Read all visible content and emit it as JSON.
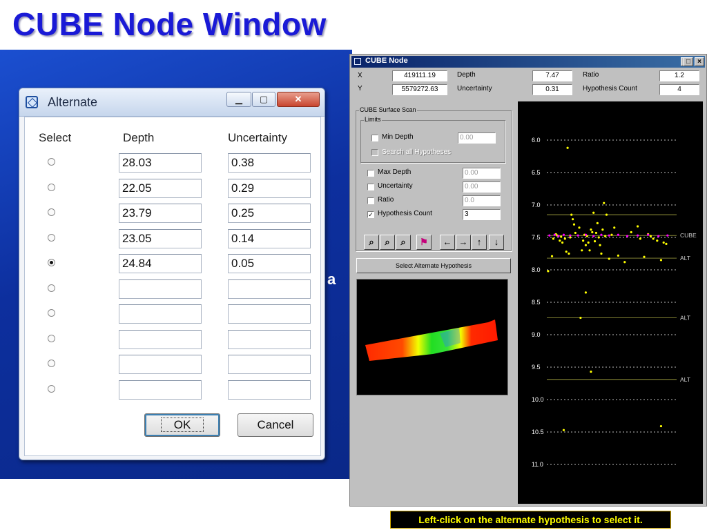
{
  "slide": {
    "title": "CUBE Node Window",
    "caption": "Left-click on the alternate hypothesis to select it.",
    "background_fragment": "a"
  },
  "alternate_dialog": {
    "title": "Alternate",
    "window_buttons": [
      "minimize-icon",
      "maximize-icon",
      "close-icon"
    ],
    "columns": {
      "select": "Select",
      "depth": "Depth",
      "uncertainty": "Uncertainty"
    },
    "rows": [
      {
        "selected": false,
        "depth": "28.03",
        "uncertainty": "0.38"
      },
      {
        "selected": false,
        "depth": "22.05",
        "uncertainty": "0.29"
      },
      {
        "selected": false,
        "depth": "23.79",
        "uncertainty": "0.25"
      },
      {
        "selected": false,
        "depth": "23.05",
        "uncertainty": "0.14"
      },
      {
        "selected": true,
        "depth": "24.84",
        "uncertainty": "0.05"
      },
      {
        "selected": false,
        "depth": "",
        "uncertainty": ""
      },
      {
        "selected": false,
        "depth": "",
        "uncertainty": ""
      },
      {
        "selected": false,
        "depth": "",
        "uncertainty": ""
      },
      {
        "selected": false,
        "depth": "",
        "uncertainty": ""
      },
      {
        "selected": false,
        "depth": "",
        "uncertainty": ""
      }
    ],
    "ok_label": "OK",
    "cancel_label": "Cancel"
  },
  "cube_node": {
    "title": "CUBE Node",
    "x_label": "X",
    "x_value": "419111.19",
    "y_label": "Y",
    "y_value": "5579272.63",
    "depth_label": "Depth",
    "depth_value": "7.47",
    "uncertainty_label": "Uncertainty",
    "uncertainty_value": "0.31",
    "ratio_label": "Ratio",
    "ratio_value": "1.2",
    "hypothesis_count_label": "Hypothesis Count",
    "hypothesis_count_value": "4",
    "scan_group": "CUBE Surface Scan",
    "limits_group": "Limits",
    "filters": {
      "min_depth": {
        "label": "Min Depth",
        "checked": false,
        "value": "0.00"
      },
      "search_all": {
        "label": "Search all Hypotheses",
        "checked": false,
        "enabled": false
      },
      "max_depth": {
        "label": "Max Depth",
        "checked": false,
        "value": "0.00"
      },
      "uncertainty": {
        "label": "Uncertainty",
        "checked": false,
        "value": "0.00"
      },
      "ratio": {
        "label": "Ratio",
        "checked": false,
        "value": "0.0"
      },
      "hypothesis_count": {
        "label": "Hypothesis Count",
        "checked": true,
        "value": "3"
      }
    },
    "toolbar": [
      "binoculars-icon",
      "binoculars-plus-icon",
      "binoculars-minus-icon",
      "scan-tool-icon",
      "arrow-left-icon",
      "arrow-right-icon",
      "arrow-up-icon",
      "arrow-down-icon"
    ],
    "select_alternate_label": "Select Alternate Hypothesis",
    "colors": {
      "plot_bg": "#000000",
      "sounding": "#ffff00",
      "selected_sounding": "#ff00ff",
      "hyp_line": "#ffff66",
      "map_red": "#ff2a00",
      "map_green": "#22dd22",
      "map_yellow": "#f2ff00"
    }
  },
  "chart_data": {
    "type": "scatter",
    "y_ticks": [
      "6.0",
      "6.5",
      "7.0",
      "7.5",
      "8.0",
      "8.5",
      "9.0",
      "9.5",
      "10.0",
      "10.5",
      "11.0"
    ],
    "y_range": [
      5.88,
      11.12
    ],
    "y_inverted": true,
    "grid": "dashed",
    "hypotheses": [
      {
        "label": "CUBE",
        "depth": 7.47
      },
      {
        "label": "ALT",
        "depth": 7.82
      },
      {
        "label": "ALT",
        "depth": 8.74
      },
      {
        "label": "ALT",
        "depth": 9.69
      },
      {
        "label": "",
        "depth": 7.15
      }
    ],
    "soundings": [
      [
        0.01,
        8.02
      ],
      [
        0.04,
        7.79
      ],
      [
        0.05,
        7.52
      ],
      [
        0.07,
        7.45
      ],
      [
        0.08,
        7.47
      ],
      [
        0.1,
        7.55
      ],
      [
        0.11,
        7.49
      ],
      [
        0.12,
        7.58
      ],
      [
        0.14,
        7.52
      ],
      [
        0.15,
        7.72
      ],
      [
        0.16,
        6.12
      ],
      [
        0.17,
        7.75
      ],
      [
        0.18,
        7.5
      ],
      [
        0.19,
        7.15
      ],
      [
        0.2,
        7.22
      ],
      [
        0.21,
        7.3
      ],
      [
        0.22,
        7.43
      ],
      [
        0.25,
        7.35
      ],
      [
        0.27,
        7.7
      ],
      [
        0.28,
        7.55
      ],
      [
        0.29,
        7.46
      ],
      [
        0.3,
        7.62
      ],
      [
        0.31,
        7.48
      ],
      [
        0.32,
        7.58
      ],
      [
        0.33,
        7.7
      ],
      [
        0.34,
        7.38
      ],
      [
        0.35,
        7.42
      ],
      [
        0.36,
        7.12
      ],
      [
        0.37,
        7.56
      ],
      [
        0.38,
        7.43
      ],
      [
        0.39,
        7.28
      ],
      [
        0.4,
        7.5
      ],
      [
        0.41,
        7.62
      ],
      [
        0.42,
        7.75
      ],
      [
        0.43,
        7.38
      ],
      [
        0.44,
        6.97
      ],
      [
        0.45,
        7.48
      ],
      [
        0.46,
        7.15
      ],
      [
        0.48,
        7.83
      ],
      [
        0.5,
        7.46
      ],
      [
        0.52,
        7.35
      ],
      [
        0.55,
        7.78
      ],
      [
        0.6,
        7.88
      ],
      [
        0.65,
        7.42
      ],
      [
        0.7,
        7.33
      ],
      [
        0.72,
        7.52
      ],
      [
        0.75,
        7.8
      ],
      [
        0.78,
        7.45
      ],
      [
        0.8,
        7.48
      ],
      [
        0.82,
        7.52
      ],
      [
        0.85,
        7.55
      ],
      [
        0.88,
        7.85
      ],
      [
        0.9,
        7.58
      ],
      [
        0.92,
        7.6
      ],
      [
        0.3,
        8.35
      ],
      [
        0.26,
        8.74
      ],
      [
        0.34,
        9.57
      ],
      [
        0.13,
        10.47
      ],
      [
        0.88,
        10.41
      ]
    ],
    "selected_soundings": [
      [
        0.02,
        7.47
      ],
      [
        0.06,
        7.46
      ],
      [
        0.09,
        7.48
      ],
      [
        0.13,
        7.46
      ],
      [
        0.18,
        7.47
      ],
      [
        0.24,
        7.47
      ],
      [
        0.3,
        7.46
      ],
      [
        0.36,
        7.48
      ],
      [
        0.42,
        7.46
      ],
      [
        0.48,
        7.47
      ],
      [
        0.55,
        7.46
      ],
      [
        0.62,
        7.48
      ],
      [
        0.7,
        7.47
      ],
      [
        0.78,
        7.46
      ],
      [
        0.86,
        7.48
      ],
      [
        0.93,
        7.47
      ]
    ]
  }
}
